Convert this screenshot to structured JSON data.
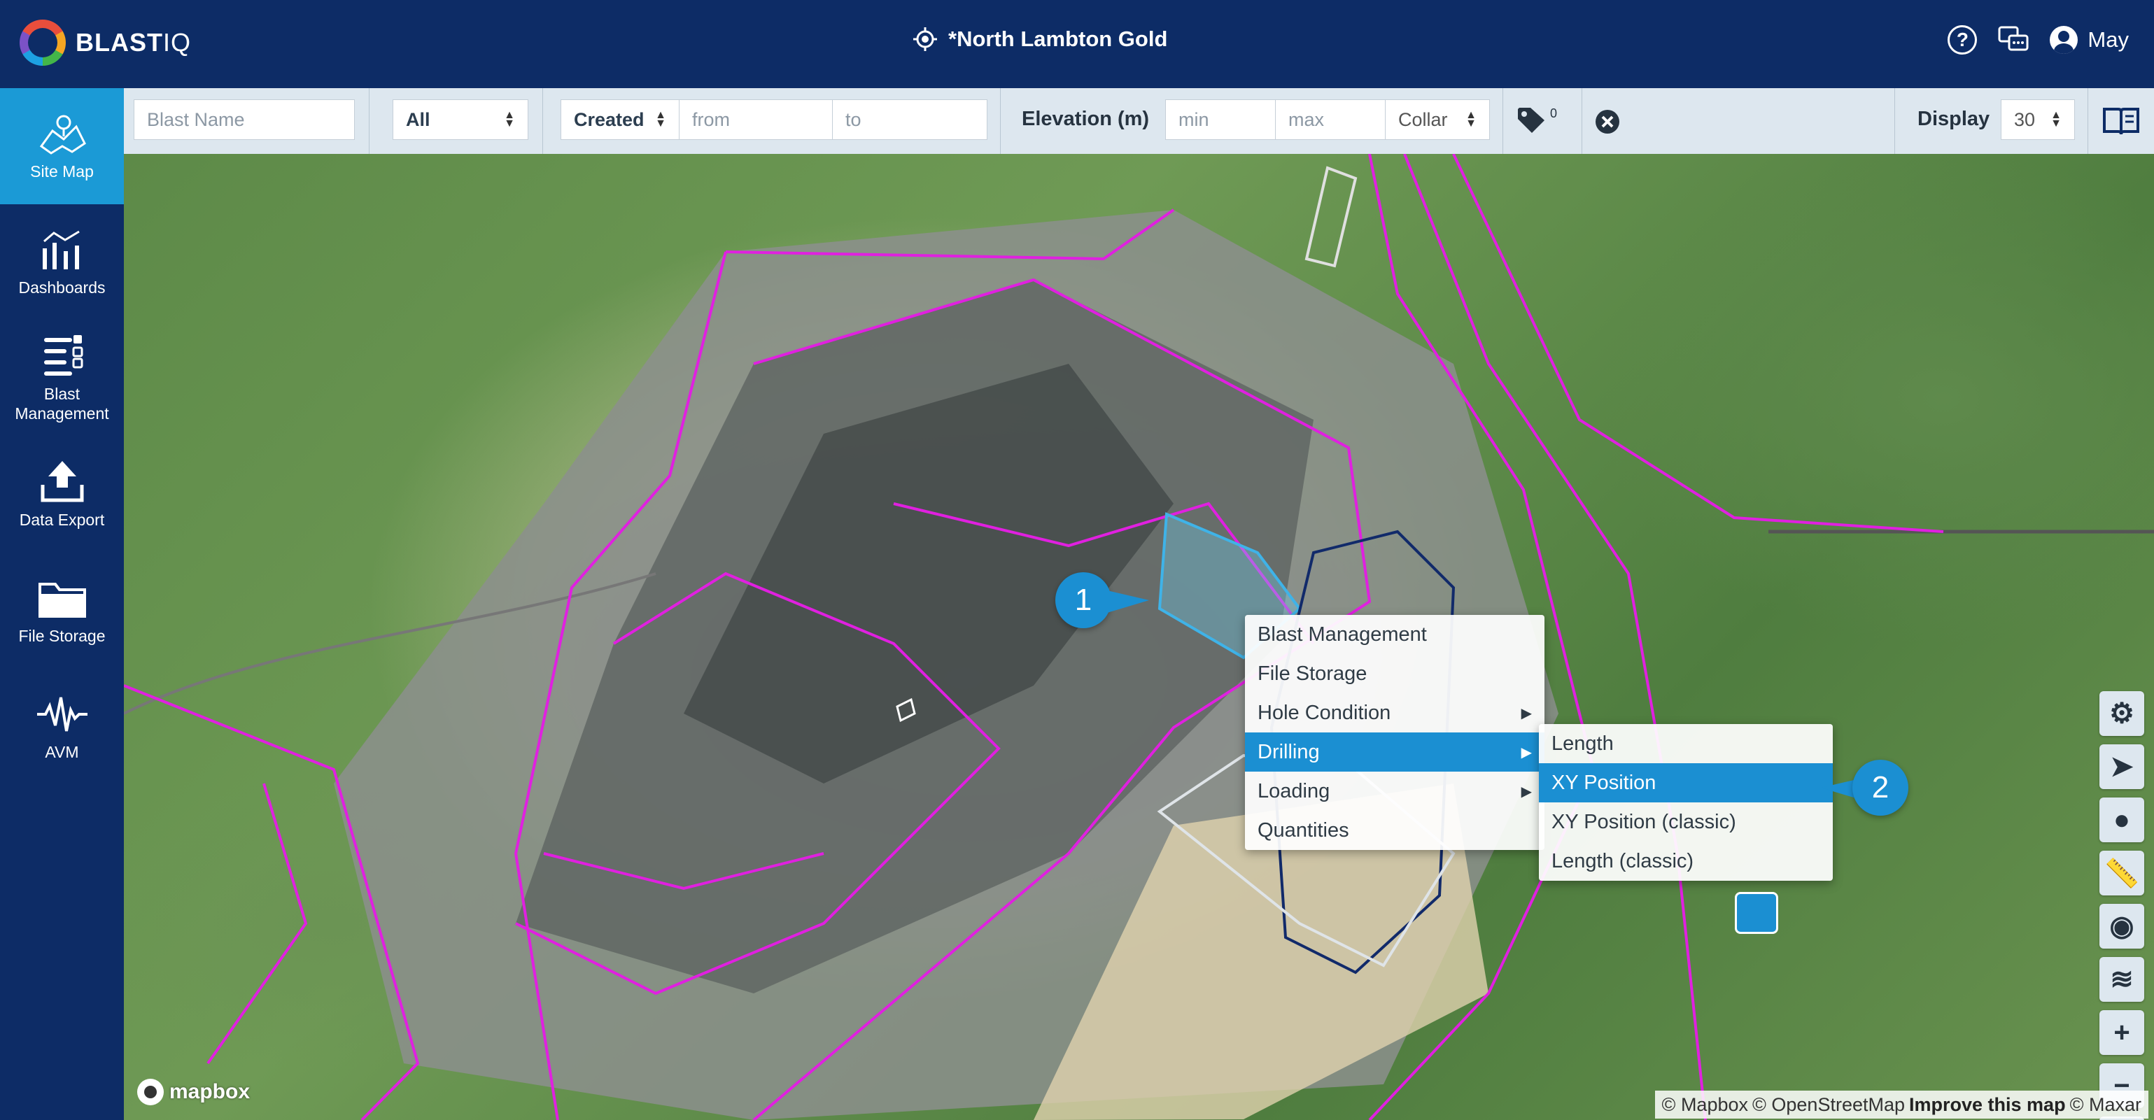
{
  "app": {
    "brand_bold": "BLAST",
    "brand_light": "IQ",
    "site_title": "*North Lambton Gold",
    "user_name": "May"
  },
  "sidebar": {
    "items": [
      {
        "label": "Site Map",
        "icon": "map-icon"
      },
      {
        "label": "Dashboards",
        "icon": "chart-icon"
      },
      {
        "label": "Blast\nManagement",
        "icon": "list-icon"
      },
      {
        "label": "Data Export",
        "icon": "upload-icon"
      },
      {
        "label": "File Storage",
        "icon": "folder-icon"
      },
      {
        "label": "AVM",
        "icon": "waveform-icon"
      }
    ]
  },
  "filters": {
    "blast_name_placeholder": "Blast Name",
    "type_value": "All",
    "date_field_value": "Created",
    "from_placeholder": "from",
    "to_placeholder": "to",
    "elevation_label": "Elevation (m)",
    "min_placeholder": "min",
    "max_placeholder": "max",
    "elevation_ref_value": "Collar",
    "tag_count": "0",
    "display_label": "Display",
    "display_value": "30"
  },
  "context_menu": {
    "items": [
      "Blast Management",
      "File Storage",
      "Hole Condition",
      "Drilling",
      "Loading",
      "Quantities"
    ],
    "selected": "Drilling",
    "submenu": [
      "Length",
      "XY Position",
      "XY Position (classic)",
      "Length (classic)"
    ],
    "submenu_selected": "XY Position"
  },
  "callouts": {
    "first": "1",
    "second": "2"
  },
  "map": {
    "logo_text": "mapbox",
    "attribution": {
      "mapbox": "© Mapbox",
      "osm": "© OpenStreetMap",
      "improve": "Improve this map",
      "maxar": "© Maxar"
    }
  },
  "colors": {
    "header": "#0d2c66",
    "accent": "#1b8fd2",
    "boundary": "#e020e0"
  }
}
